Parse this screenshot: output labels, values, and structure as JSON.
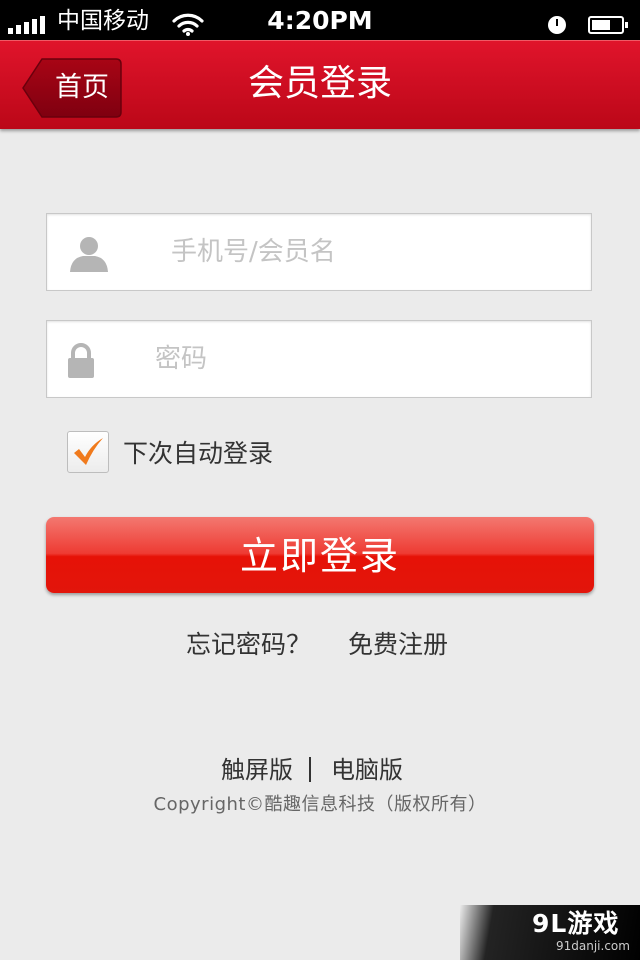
{
  "status_bar": {
    "carrier": "中国移动",
    "time": "4:20PM"
  },
  "nav": {
    "back_label": "首页",
    "title": "会员登录"
  },
  "form": {
    "username_placeholder": "手机号/会员名",
    "username_value": "",
    "password_placeholder": "密码",
    "password_value": "",
    "remember_label": "下次自动登录",
    "remember_checked": true,
    "login_button": "立即登录"
  },
  "links": {
    "forgot": "忘记密码？",
    "register": "免费注册"
  },
  "footer": {
    "touch_version": "触屏版",
    "pc_version": "电脑版",
    "copyright": "Copyright©酷趣信息科技（版权所有）"
  },
  "watermark": {
    "logo": "9L游戏",
    "site": "91danji.com"
  },
  "colors": {
    "nav_red": "#d20f22",
    "button_red": "#e61207",
    "check_orange": "#f07a1c",
    "background": "#ebebeb"
  },
  "icons": {
    "username": "user-icon",
    "password": "lock-icon",
    "back": "back-arrow-icon",
    "remember": "checkmark-icon"
  }
}
